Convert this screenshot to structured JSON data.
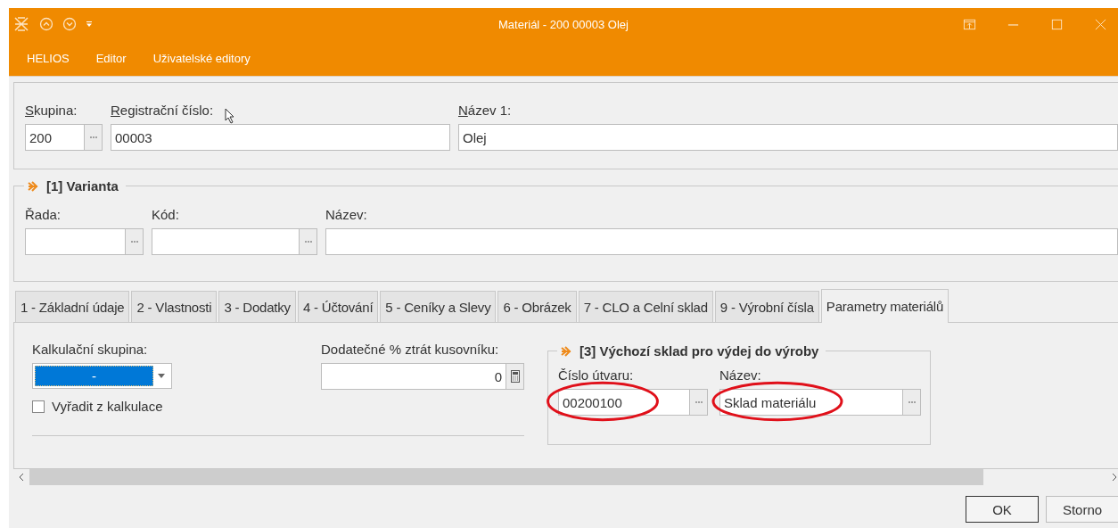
{
  "window": {
    "title": "Materiál - 200 00003 Olej"
  },
  "menu": [
    {
      "label": "HELIOS"
    },
    {
      "label": "Editor"
    },
    {
      "label": "Uživatelské editory"
    }
  ],
  "header": {
    "fields": [
      {
        "label": "Skupina:",
        "mnemonic": true,
        "value": "200",
        "kind": "lookup"
      },
      {
        "label": "Registrační číslo:",
        "mnemonic": true,
        "value": "00003",
        "kind": "text"
      },
      {
        "label": "Název 1:",
        "mnemonic": true,
        "value": "Olej",
        "kind": "text"
      }
    ]
  },
  "variant_group": {
    "title": "[1] Varianta",
    "fields": [
      {
        "label": "Řada:",
        "kind": "lookup"
      },
      {
        "label": "Kód:",
        "kind": "lookup"
      },
      {
        "label": "Název:",
        "kind": "text"
      }
    ]
  },
  "tabs": [
    {
      "label": "1 - Základní údaje",
      "selected": false
    },
    {
      "label": "2 - Vlastnosti",
      "selected": false
    },
    {
      "label": "3 - Dodatky",
      "selected": false
    },
    {
      "label": "4 - Účtování",
      "selected": false
    },
    {
      "label": "5 - Ceníky a Slevy",
      "selected": false
    },
    {
      "label": "6 - Obrázek",
      "selected": false
    },
    {
      "label": "7 - CLO a Celní sklad",
      "selected": false
    },
    {
      "label": "9 - Výrobní čísla",
      "selected": false
    },
    {
      "label": "Parametry materiálů",
      "selected": true
    }
  ],
  "tab_content": {
    "calc_group": {
      "label": "Kalkulační skupina:",
      "value": "-",
      "kind": "dropdown"
    },
    "exclude_checkbox": {
      "label": "Vyřadit z kalkulace",
      "checked": false
    },
    "loss_field": {
      "label": "Dodatečné % ztrát kusovníku:",
      "value": "0",
      "kind": "calc"
    },
    "warehouse_group": {
      "title": "[3] Výchozí sklad pro výdej do výroby",
      "fields": [
        {
          "label": "Číslo útvaru:",
          "value": "00200100",
          "kind": "lookup",
          "annotated": true
        },
        {
          "label": "Název:",
          "value": "Sklad materiálu",
          "kind": "lookup",
          "annotated": true
        }
      ]
    }
  },
  "buttons": [
    {
      "label": "OK",
      "default": true
    },
    {
      "label": "Storno",
      "default": false
    }
  ]
}
